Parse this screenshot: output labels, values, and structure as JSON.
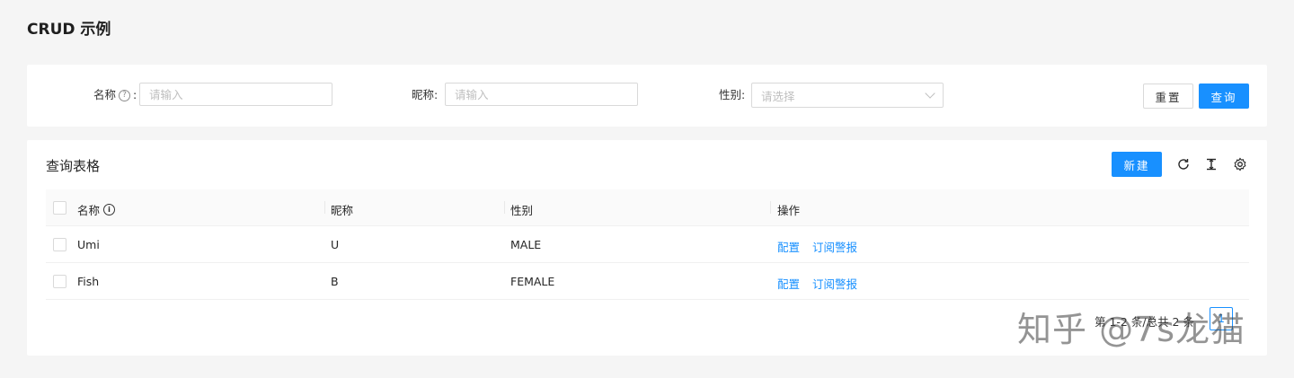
{
  "page": {
    "title": "CRUD 示例"
  },
  "search": {
    "name_label": "名称",
    "name_placeholder": "请输入",
    "nickname_label": "昵称:",
    "nickname_placeholder": "请输入",
    "gender_label": "性别:",
    "gender_placeholder": "请选择",
    "reset_label": "重置",
    "query_label": "查询",
    "help_icon": "question-circle-icon"
  },
  "table": {
    "title": "查询表格",
    "new_label": "新建",
    "columns": [
      "名称",
      "昵称",
      "性别",
      "操作"
    ],
    "rows": [
      {
        "name": "Umi",
        "nickname": "U",
        "gender": "MALE",
        "actions": [
          "配置",
          "订阅警报"
        ]
      },
      {
        "name": "Fish",
        "nickname": "B",
        "gender": "FEMALE",
        "actions": [
          "配置",
          "订阅警报"
        ]
      }
    ]
  },
  "pagination": {
    "summary": "第 1-2 条/总共 2 条",
    "current_page": "1"
  },
  "watermark": {
    "text": "知乎 @7s龙猫"
  },
  "colors": {
    "primary": "#1890ff",
    "background": "#f5f5f5"
  }
}
